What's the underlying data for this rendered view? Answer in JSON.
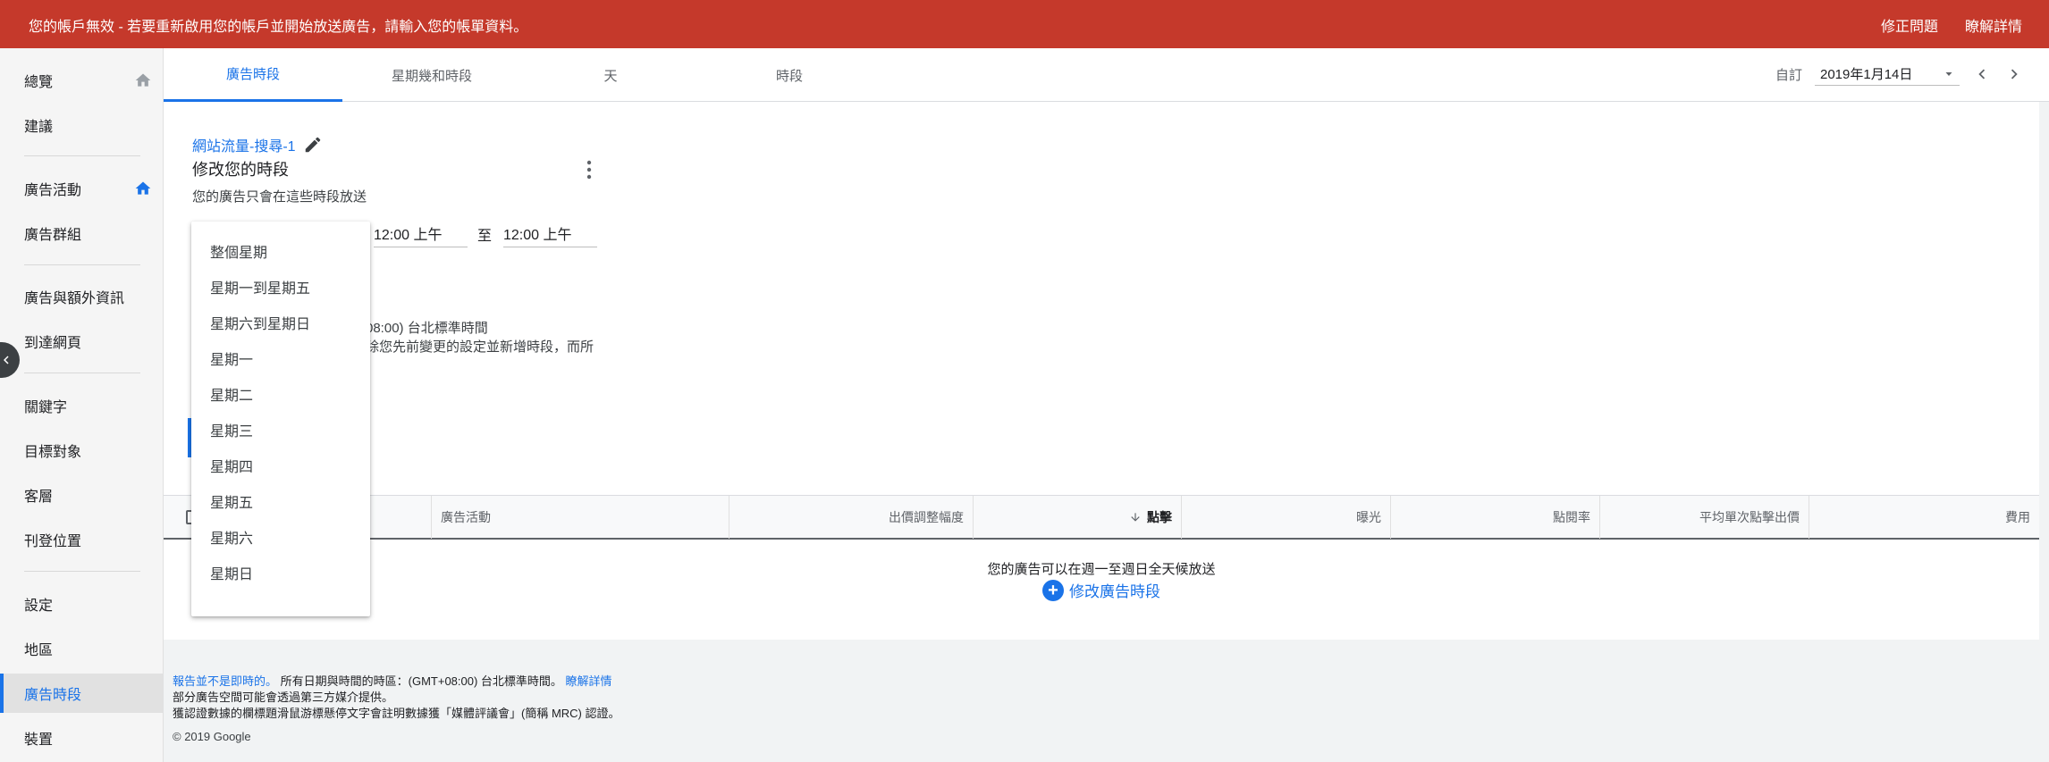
{
  "banner": {
    "message": "您的帳戶無效 - 若要重新啟用您的帳戶並開始放送廣告，請輸入您的帳單資料。",
    "fix_label": "修正問題",
    "learn_label": "瞭解詳情"
  },
  "sidebar": {
    "items": [
      {
        "label": "總覽"
      },
      {
        "label": "建議"
      },
      {
        "label": "廣告活動"
      },
      {
        "label": "廣告群組"
      },
      {
        "label": "廣告與額外資訊"
      },
      {
        "label": "到達網頁"
      },
      {
        "label": "關鍵字"
      },
      {
        "label": "目標對象"
      },
      {
        "label": "客層"
      },
      {
        "label": "刊登位置"
      },
      {
        "label": "設定"
      },
      {
        "label": "地區"
      },
      {
        "label": "廣告時段"
      },
      {
        "label": "裝置"
      }
    ]
  },
  "tabs": [
    {
      "label": "廣告時段"
    },
    {
      "label": "星期幾和時段"
    },
    {
      "label": "天"
    },
    {
      "label": "時段"
    }
  ],
  "date": {
    "prefix": "自訂",
    "value": "2019年1月14日"
  },
  "card": {
    "campaign": "網站流量-搜尋-1",
    "subtitle": "修改您的時段",
    "description": "您的廣告只會在這些時段放送",
    "start_time": "12:00 上午",
    "to": "至",
    "end_time": "12:00 上午",
    "timezone": "08:00) 台北標準時間",
    "warning": "除您先前變更的設定並新增時段，而所"
  },
  "dropdown": {
    "options": [
      "整個星期",
      "星期一到星期五",
      "星期六到星期日",
      "星期一",
      "星期二",
      "星期三",
      "星期四",
      "星期五",
      "星期六",
      "星期日"
    ]
  },
  "table": {
    "columns": [
      "廣告活動",
      "出價調整幅度",
      "點擊",
      "曝光",
      "點閱率",
      "平均單次點擊出價",
      "費用"
    ],
    "empty_message": "您的廣告可以在週一至週日全天候放送",
    "modify_link": "修改廣告時段"
  },
  "footer": {
    "realtime_link": "報告並不是即時的。",
    "timezone_note": "所有日期與時間的時區：(GMT+08:00) 台北標準時間。",
    "learn_link": "瞭解詳情",
    "third_party": "部分廣告空間可能會透過第三方媒介提供。",
    "mrc": "獲認證數據的欄標題滑鼠游標懸停文字會註明數據獲「媒體評議會」(簡稱 MRC) 認證。",
    "copyright": "© 2019 Google"
  },
  "colors": {
    "banner": "#c5392b",
    "accent": "#1a73e8"
  }
}
